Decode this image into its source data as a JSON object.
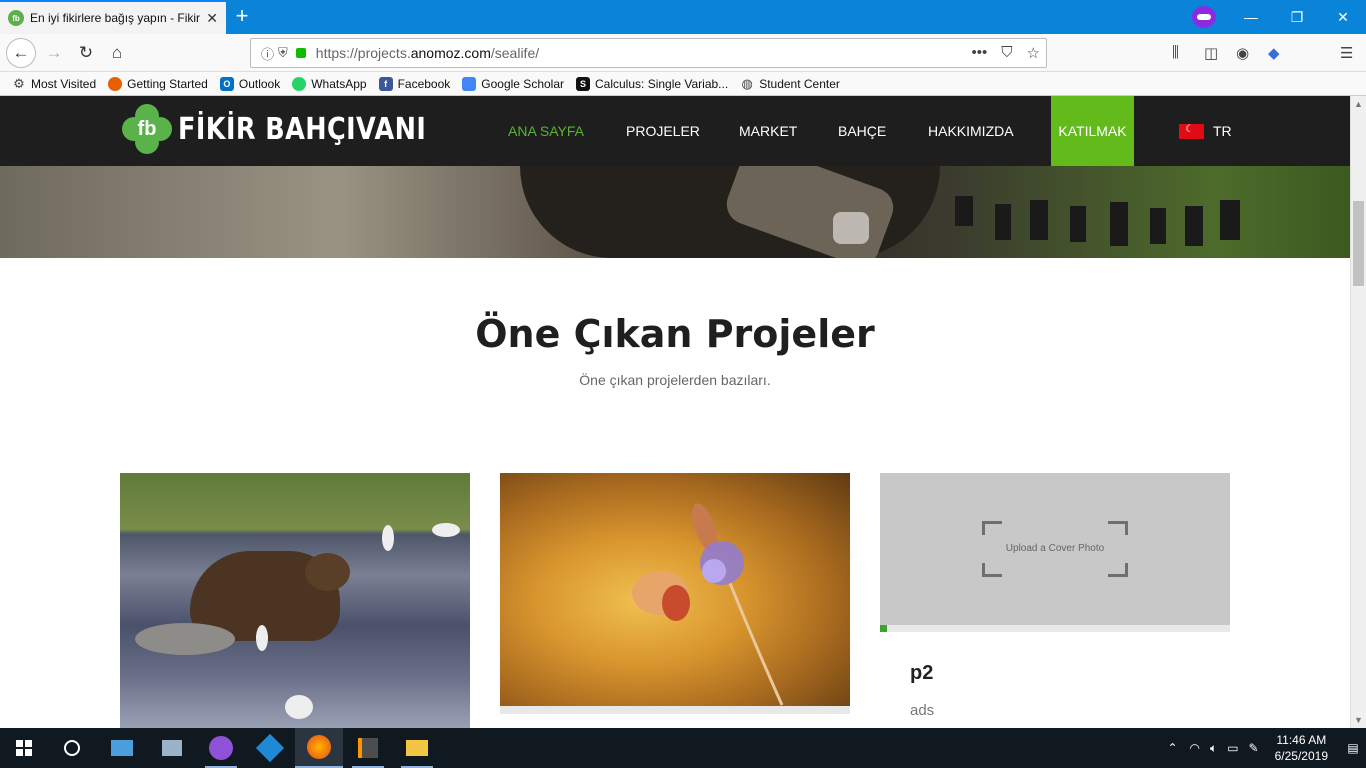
{
  "browser": {
    "tab_title": "En iyi fikirlere bağış yapın - Fikir",
    "url_prefix": "https://projects.",
    "url_domain": "anomoz.com",
    "url_path": "/sealife/",
    "more": "•••"
  },
  "bookmarks": [
    {
      "label": "Most Visited",
      "icon": "gear-icon"
    },
    {
      "label": "Getting Started",
      "icon": "firefox-icon"
    },
    {
      "label": "Outlook",
      "icon": "outlook-icon"
    },
    {
      "label": "WhatsApp",
      "icon": "whatsapp-icon"
    },
    {
      "label": "Facebook",
      "icon": "facebook-icon"
    },
    {
      "label": "Google Scholar",
      "icon": "scholar-icon"
    },
    {
      "label": "Calculus: Single Variab...",
      "icon": "s-icon"
    },
    {
      "label": "Student Center",
      "icon": "globe-icon"
    }
  ],
  "site": {
    "logo_text": "FİKİR BAHÇIVANI",
    "logo_mark": "fb",
    "nav": [
      "ANA SAYFA",
      "PROJELER",
      "MARKET",
      "BAHÇE",
      "HAKKIMIZDA"
    ],
    "join": "KATILMAK",
    "lang": "TR",
    "colors": {
      "accent": "#62bb1b",
      "header_bg": "#1e1e1e",
      "active_nav": "#5bb230"
    }
  },
  "featured": {
    "title": "Öne Çıkan Projeler",
    "subtitle": "Öne çıkan projelerden bazıları."
  },
  "cards": {
    "card3_upload": "Upload a Cover Photo",
    "card3_title": "p2",
    "card3_desc": "ads",
    "card3_progress": 0.02
  },
  "taskbar": {
    "time": "11:46 AM",
    "date": "6/25/2019"
  }
}
